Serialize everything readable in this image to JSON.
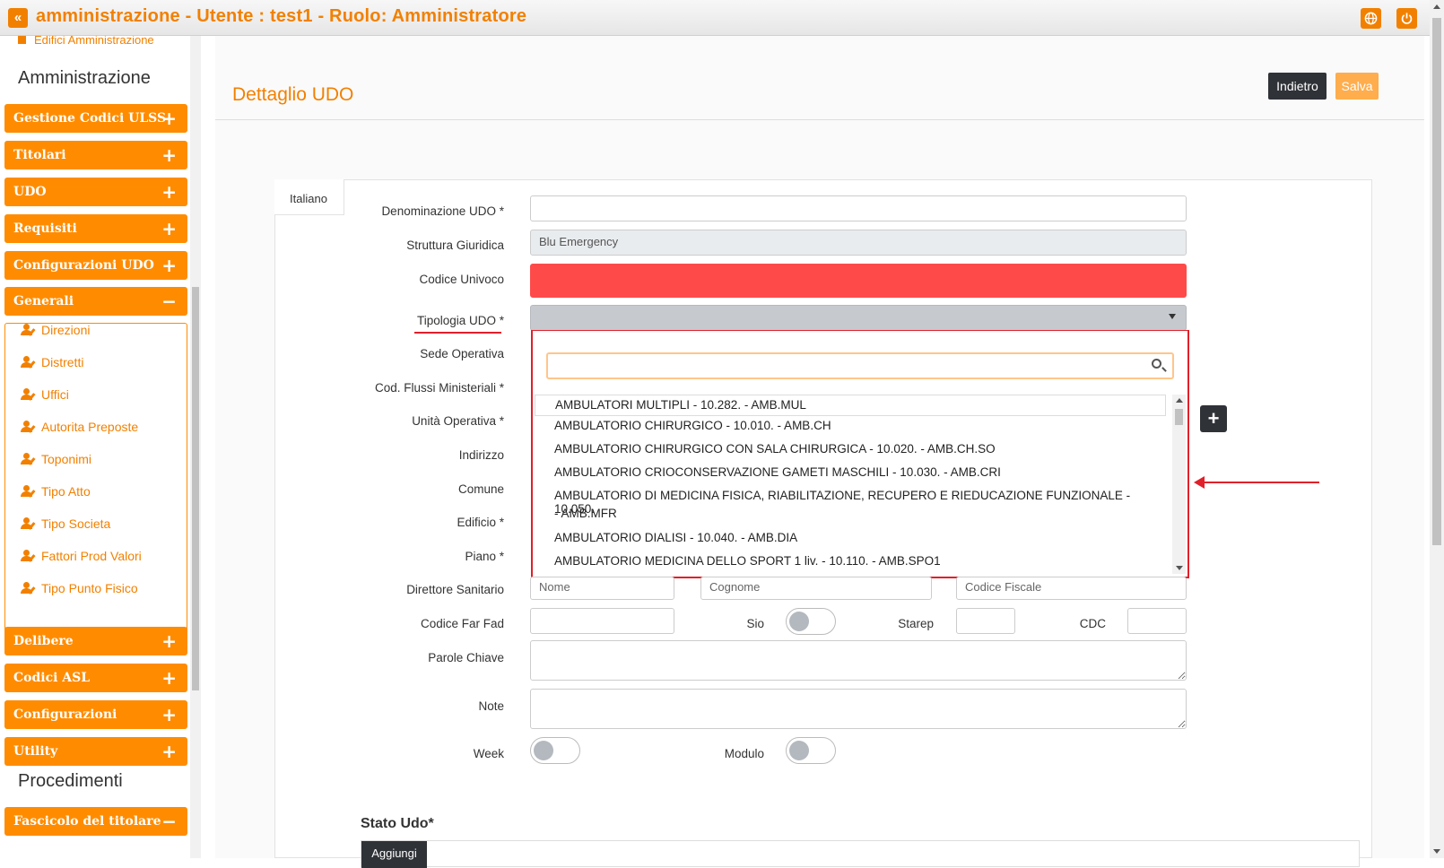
{
  "topbar": {
    "collapse_icon": "double-chevron-left-icon",
    "title": "amministrazione - Utente : test1 - Ruolo: Amministratore",
    "accent": "#f28000",
    "globe_icon": "globe-icon",
    "power_icon": "power-icon"
  },
  "sidebar": {
    "top_link": "Edifici Amministrazione",
    "section_admin": "Amministrazione",
    "section_proc": "Procedimenti",
    "buttons": [
      {
        "label": "Gestione Codici ULSS",
        "sign": "+"
      },
      {
        "label": "Titolari",
        "sign": "+"
      },
      {
        "label": "UDO",
        "sign": "+"
      },
      {
        "label": "Requisiti",
        "sign": "+"
      },
      {
        "label": "Configurazioni UDO",
        "sign": "+"
      },
      {
        "label": "Generali",
        "sign": "−"
      },
      {
        "label": "Delibere",
        "sign": "+"
      },
      {
        "label": "Codici ASL",
        "sign": "+"
      },
      {
        "label": "Configurazioni",
        "sign": "+"
      },
      {
        "label": "Utility",
        "sign": "+"
      },
      {
        "label": "Fascicolo del titolare",
        "sign": "−"
      }
    ],
    "generali_items": [
      "Direzioni",
      "Distretti",
      "Uffici",
      "Autorita Preposte",
      "Toponimi",
      "Tipo Atto",
      "Tipo Societa",
      "Fattori Prod Valori",
      "Tipo Punto Fisico"
    ]
  },
  "main": {
    "title": "Dettaglio UDO",
    "btn_back": "Indietro",
    "btn_save": "Salva",
    "tab": "Italiano",
    "labels": {
      "denominazione": "Denominazione UDO *",
      "struttura": "Struttura Giuridica",
      "codice": "Codice Univoco",
      "tipologia": "Tipologia UDO *",
      "sede": "Sede Operativa",
      "flussi": "Cod. Flussi Ministeriali *",
      "unita": "Unità Operativa *",
      "indirizzo": "Indirizzo",
      "comune": "Comune",
      "edificio": "Edificio *",
      "piano": "Piano *",
      "direttore": "Direttore Sanitario",
      "farfad": "Codice Far Fad",
      "sio": "Sio",
      "starep": "Starep",
      "cdc": "CDC",
      "parole": "Parole Chiave",
      "note": "Note",
      "week": "Week",
      "modulo": "Modulo"
    },
    "values": {
      "struttura": "Blu Emergency"
    },
    "placeholders": {
      "nome": "Nome",
      "cognome": "Cognome",
      "codice_fiscale": "Codice Fiscale"
    },
    "dropdown_options": [
      "AMBULATORI MULTIPLI - 10.282. - AMB.MUL",
      "AMBULATORIO CHIRURGICO - 10.010. - AMB.CH",
      "AMBULATORIO CHIRURGICO CON SALA CHIRURGICA - 10.020. - AMB.CH.SO",
      "AMBULATORIO CRIOCONSERVAZIONE GAMETI MASCHILI - 10.030. - AMB.CRI",
      "AMBULATORIO DI MEDICINA FISICA, RIABILITAZIONE, RECUPERO E RIEDUCAZIONE FUNZIONALE - 10.050.",
      "- AMB.MFR",
      "AMBULATORIO DIALISI - 10.040. - AMB.DIA",
      "AMBULATORIO MEDICINA DELLO SPORT 1 liv. - 10.110. - AMB.SPO1"
    ],
    "stato_title": "Stato Udo*",
    "btn_aggiungi": "Aggiungi"
  }
}
